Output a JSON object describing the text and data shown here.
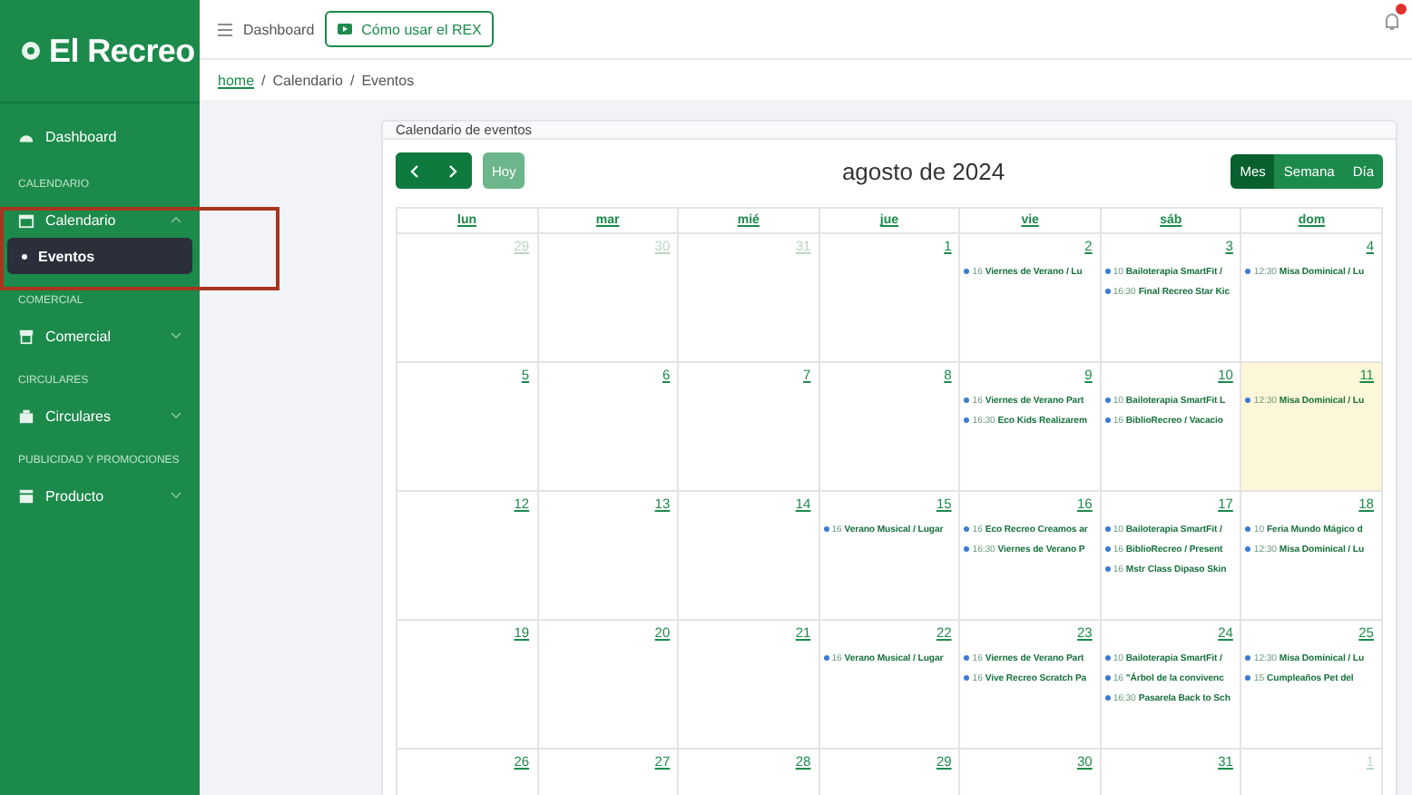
{
  "sidebar": {
    "logo": "El Recreo",
    "sections": [
      {
        "items": [
          {
            "label": "Dashboard"
          }
        ]
      },
      {
        "heading": "CALENDARIO",
        "items": [
          {
            "label": "Calendario",
            "expanded": true,
            "children": [
              {
                "label": "Eventos",
                "selected": true
              }
            ]
          }
        ]
      },
      {
        "heading": "COMERCIAL",
        "items": [
          {
            "label": "Comercial",
            "expanded": false
          }
        ]
      },
      {
        "heading": "CIRCULARES",
        "items": [
          {
            "label": "Circulares",
            "expanded": false
          }
        ]
      },
      {
        "heading": "PUBLICIDAD Y PROMOCIONES",
        "items": [
          {
            "label": "Producto",
            "expanded": false
          }
        ]
      }
    ]
  },
  "topbar": {
    "title": "Dashboard",
    "help_button": "Cómo usar el REX"
  },
  "breadcrumb": {
    "separator": "/",
    "items": [
      {
        "label": "home",
        "link": true
      },
      {
        "label": "Calendario",
        "link": false
      },
      {
        "label": "Eventos",
        "link": false
      }
    ]
  },
  "card": {
    "title": "Calendario de eventos",
    "today_button": "Hoy",
    "month_title": "agosto de 2024",
    "views": [
      {
        "label": "Mes",
        "selected": true
      },
      {
        "label": "Semana",
        "selected": false
      },
      {
        "label": "Día",
        "selected": false
      }
    ],
    "weekdays": [
      "lun",
      "mar",
      "mié",
      "jue",
      "vie",
      "sáb",
      "dom"
    ],
    "weeks": [
      [
        {
          "day": "29",
          "other_month": true,
          "today": false
        },
        {
          "day": "30",
          "other_month": true,
          "today": false
        },
        {
          "day": "31",
          "other_month": true,
          "today": false
        },
        {
          "day": "1",
          "other_month": false,
          "today": false
        },
        {
          "day": "2",
          "other_month": false,
          "today": false,
          "events": [
            {
              "time": "16",
              "title": "Viernes de Verano / Lu"
            }
          ]
        },
        {
          "day": "3",
          "other_month": false,
          "today": false,
          "events": [
            {
              "time": "10",
              "title": "Bailoterapia SmartFit /"
            },
            {
              "time": "16:30",
              "title": "Final Recreo Star Kic"
            }
          ]
        },
        {
          "day": "4",
          "other_month": false,
          "today": false,
          "events": [
            {
              "time": "12:30",
              "title": "Misa Dominical / Lu"
            }
          ]
        }
      ],
      [
        {
          "day": "5",
          "other_month": false,
          "today": false
        },
        {
          "day": "6",
          "other_month": false,
          "today": false
        },
        {
          "day": "7",
          "other_month": false,
          "today": false
        },
        {
          "day": "8",
          "other_month": false,
          "today": false
        },
        {
          "day": "9",
          "other_month": false,
          "today": false,
          "events": [
            {
              "time": "16",
              "title": "Viernes de Verano Part"
            },
            {
              "time": "16:30",
              "title": "Eco Kids Realizarem"
            }
          ]
        },
        {
          "day": "10",
          "other_month": false,
          "today": false,
          "events": [
            {
              "time": "10",
              "title": "Bailoterapia SmartFit L"
            },
            {
              "time": "16",
              "title": "BiblioRecreo / Vacacio"
            }
          ]
        },
        {
          "day": "11",
          "other_month": false,
          "today": true,
          "events": [
            {
              "time": "12:30",
              "title": "Misa Dominical / Lu"
            }
          ]
        }
      ],
      [
        {
          "day": "12",
          "other_month": false,
          "today": false
        },
        {
          "day": "13",
          "other_month": false,
          "today": false
        },
        {
          "day": "14",
          "other_month": false,
          "today": false
        },
        {
          "day": "15",
          "other_month": false,
          "today": false,
          "events": [
            {
              "time": "16",
              "title": "Verano Musical / Lugar"
            }
          ]
        },
        {
          "day": "16",
          "other_month": false,
          "today": false,
          "events": [
            {
              "time": "16",
              "title": "Eco Recreo Creamos ar"
            },
            {
              "time": "16:30",
              "title": "Viernes de Verano P"
            }
          ]
        },
        {
          "day": "17",
          "other_month": false,
          "today": false,
          "events": [
            {
              "time": "10",
              "title": "Bailoterapia SmartFit /"
            },
            {
              "time": "16",
              "title": "BiblioRecreo / Present"
            },
            {
              "time": "16",
              "title": "Mstr Class Dipaso Skin"
            }
          ]
        },
        {
          "day": "18",
          "other_month": false,
          "today": false,
          "events": [
            {
              "time": "10",
              "title": "Feria Mundo Mágico d"
            },
            {
              "time": "12:30",
              "title": "Misa Dominical / Lu"
            }
          ]
        }
      ],
      [
        {
          "day": "19",
          "other_month": false,
          "today": false
        },
        {
          "day": "20",
          "other_month": false,
          "today": false
        },
        {
          "day": "21",
          "other_month": false,
          "today": false
        },
        {
          "day": "22",
          "other_month": false,
          "today": false,
          "events": [
            {
              "time": "16",
              "title": "Verano Musical / Lugar"
            }
          ]
        },
        {
          "day": "23",
          "other_month": false,
          "today": false,
          "events": [
            {
              "time": "16",
              "title": "Viernes de Verano Part"
            },
            {
              "time": "16",
              "title": "Vive Recreo Scratch Pa"
            }
          ]
        },
        {
          "day": "24",
          "other_month": false,
          "today": false,
          "events": [
            {
              "time": "10",
              "title": "Bailoterapia SmartFit /"
            },
            {
              "time": "16",
              "title": "\"Árbol de la convivenc"
            },
            {
              "time": "16:30",
              "title": "Pasarela Back to Sch"
            }
          ]
        },
        {
          "day": "25",
          "other_month": false,
          "today": false,
          "events": [
            {
              "time": "12:30",
              "title": "Misa Dominical / Lu"
            },
            {
              "time": "15",
              "title": "Cumpleaños Pet del"
            }
          ]
        }
      ],
      [
        {
          "day": "26",
          "other_month": false,
          "today": false
        },
        {
          "day": "27",
          "other_month": false,
          "today": false
        },
        {
          "day": "28",
          "other_month": false,
          "today": false
        },
        {
          "day": "29",
          "other_month": false,
          "today": false
        },
        {
          "day": "30",
          "other_month": false,
          "today": false
        },
        {
          "day": "31",
          "other_month": false,
          "today": false
        },
        {
          "day": "1",
          "other_month": true,
          "today": false
        }
      ]
    ]
  }
}
